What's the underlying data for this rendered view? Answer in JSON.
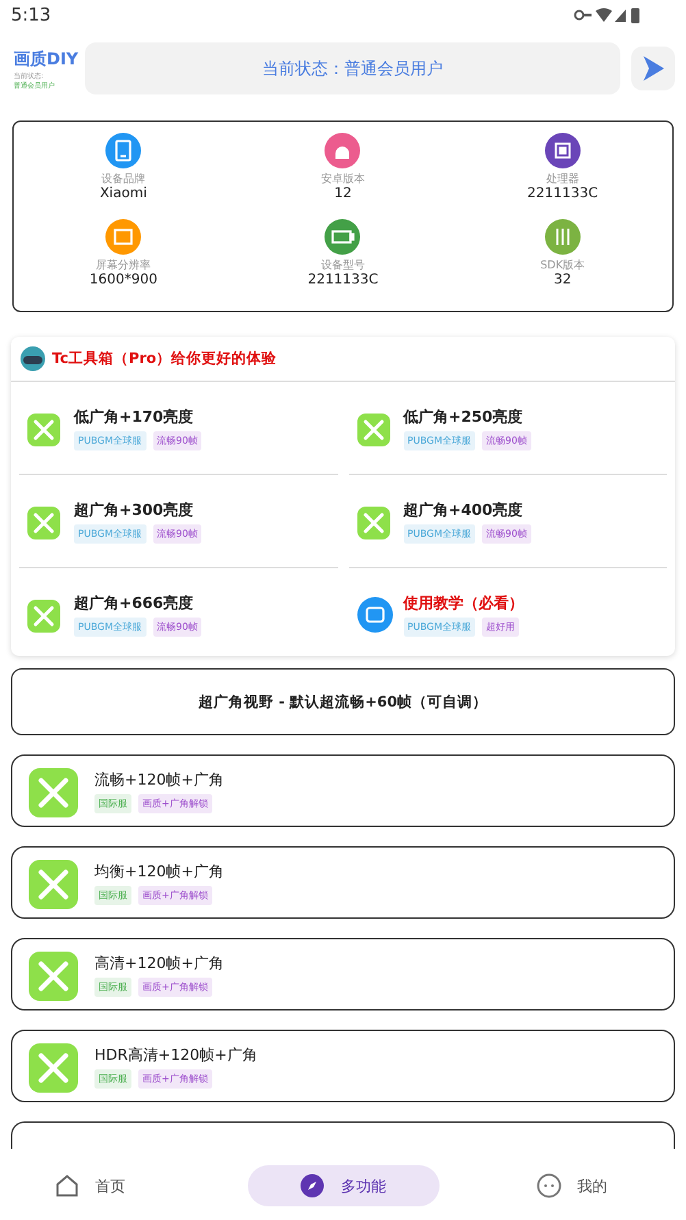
{
  "status_bar": {
    "time": "5:13"
  },
  "header": {
    "logo": "画质DIY",
    "sub_label": "当前状态:",
    "sub_value": "普通会员用户",
    "status": "当前状态：普通会员用户"
  },
  "device_info": [
    {
      "label": "设备品牌",
      "value": "Xiaomi",
      "kind": "tablet",
      "color": "#2196f3"
    },
    {
      "label": "安卓版本",
      "value": "12",
      "kind": "android",
      "color": "#ec5c8e"
    },
    {
      "label": "处理器",
      "value": "2211133C",
      "kind": "chip",
      "color": "#6a45b8"
    },
    {
      "label": "屏幕分辨率",
      "value": "1600*900",
      "kind": "screen",
      "color": "#ff9800"
    },
    {
      "label": "设备型号",
      "value": "2211133C",
      "kind": "battery",
      "color": "#43a047"
    },
    {
      "label": "SDK版本",
      "value": "32",
      "kind": "sliders",
      "color": "#7cb342"
    }
  ],
  "pro_section": {
    "title": "Tc工具箱（Pro）给你更好的体验",
    "items": [
      {
        "title": "低广角+170亮度",
        "kind": "tool",
        "highlight": false,
        "tags": [
          {
            "text": "PUBGM全球服",
            "color": "#4aa8d8"
          },
          {
            "text": "流畅90帧",
            "color": "#9c4dcc"
          }
        ]
      },
      {
        "title": "低广角+250亮度",
        "kind": "tool",
        "highlight": false,
        "tags": [
          {
            "text": "PUBGM全球服",
            "color": "#4aa8d8"
          },
          {
            "text": "流畅90帧",
            "color": "#9c4dcc"
          }
        ]
      },
      {
        "title": "超广角+300亮度",
        "kind": "tool",
        "highlight": false,
        "tags": [
          {
            "text": "PUBGM全球服",
            "color": "#4aa8d8"
          },
          {
            "text": "流畅90帧",
            "color": "#9c4dcc"
          }
        ]
      },
      {
        "title": "超广角+400亮度",
        "kind": "tool",
        "highlight": false,
        "tags": [
          {
            "text": "PUBGM全球服",
            "color": "#4aa8d8"
          },
          {
            "text": "流畅90帧",
            "color": "#9c4dcc"
          }
        ]
      },
      {
        "title": "超广角+666亮度",
        "kind": "tool",
        "highlight": false,
        "tags": [
          {
            "text": "PUBGM全球服",
            "color": "#4aa8d8"
          },
          {
            "text": "流畅90帧",
            "color": "#9c4dcc"
          }
        ]
      },
      {
        "title": "使用教学（必看）",
        "kind": "tutorial",
        "highlight": true,
        "tags": [
          {
            "text": "PUBGM全球服",
            "color": "#4aa8d8"
          },
          {
            "text": "超好用",
            "color": "#9c4dcc"
          }
        ]
      }
    ]
  },
  "wide_button": "超广角视野 - 默认超流畅+60帧（可自调）",
  "presets": [
    {
      "title": "流畅+120帧+广角",
      "tags": [
        {
          "text": "国际服",
          "color": "#4caf50"
        },
        {
          "text": "画质+广角解锁",
          "color": "#9c4dcc"
        }
      ]
    },
    {
      "title": "均衡+120帧+广角",
      "tags": [
        {
          "text": "国际服",
          "color": "#4caf50"
        },
        {
          "text": "画质+广角解锁",
          "color": "#9c4dcc"
        }
      ]
    },
    {
      "title": "高清+120帧+广角",
      "tags": [
        {
          "text": "国际服",
          "color": "#4caf50"
        },
        {
          "text": "画质+广角解锁",
          "color": "#9c4dcc"
        }
      ]
    },
    {
      "title": "HDR高清+120帧+广角",
      "tags": [
        {
          "text": "国际服",
          "color": "#4caf50"
        },
        {
          "text": "画质+广角解锁",
          "color": "#9c4dcc"
        }
      ]
    }
  ],
  "bottom_nav": [
    {
      "label": "首页",
      "kind": "home",
      "selected": false
    },
    {
      "label": "多功能",
      "kind": "compass",
      "selected": true
    },
    {
      "label": "我的",
      "kind": "face",
      "selected": false
    }
  ]
}
